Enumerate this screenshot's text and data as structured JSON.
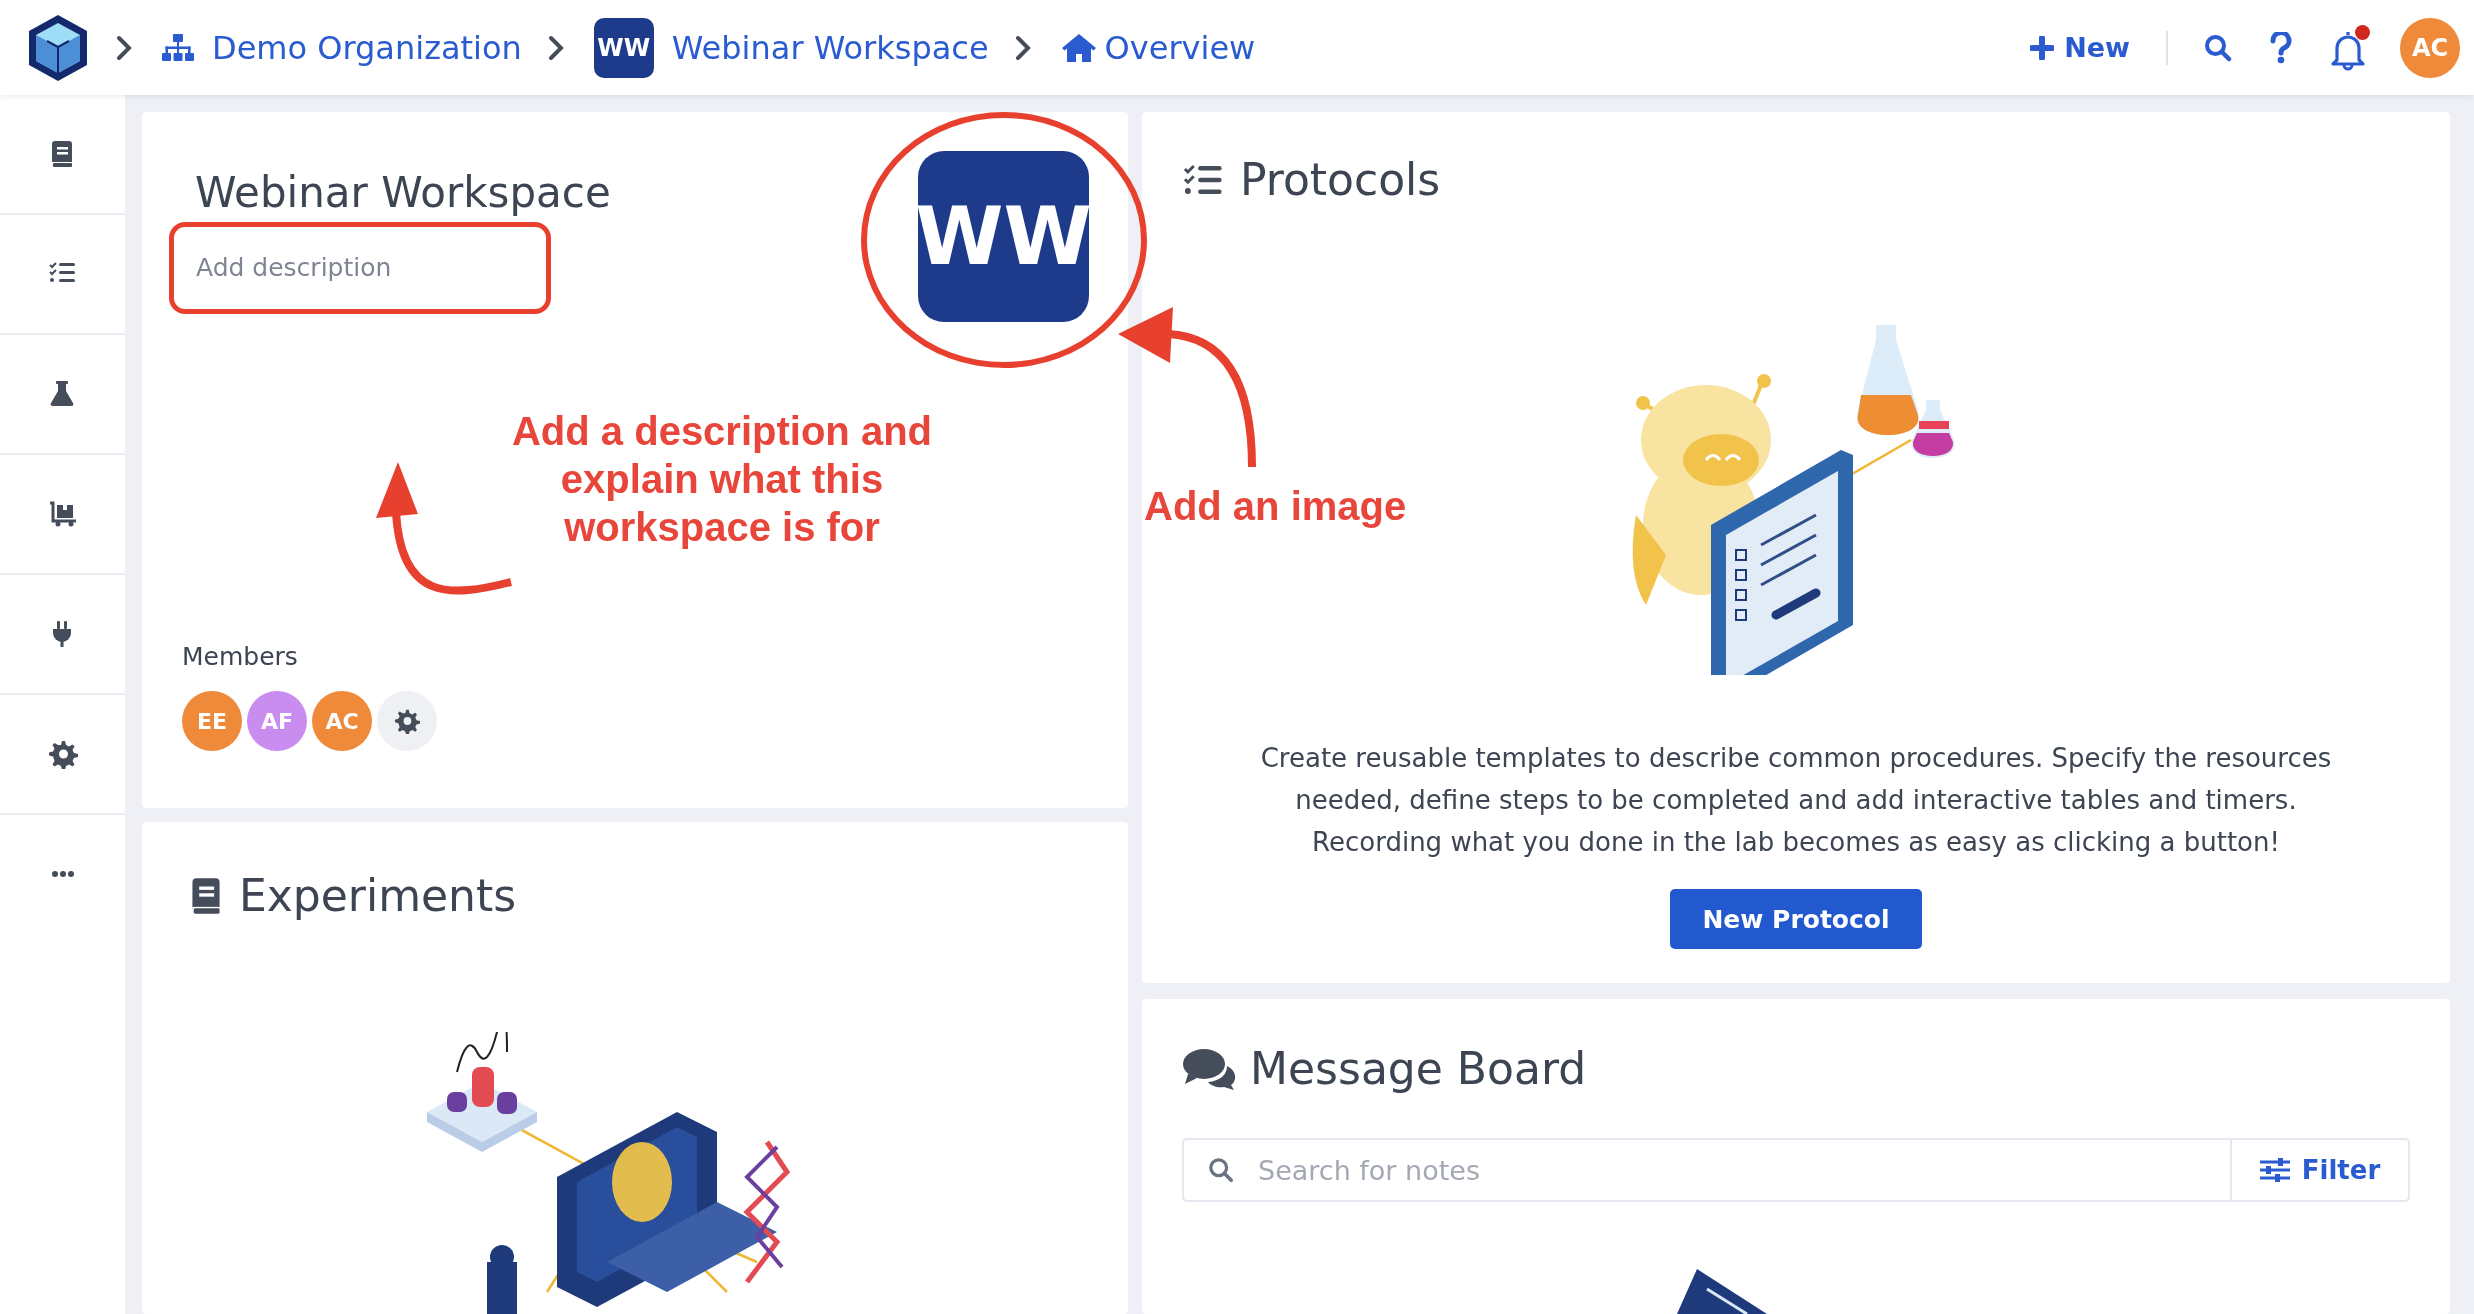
{
  "breadcrumb": [
    {
      "kind": "org",
      "label": "Demo Organization"
    },
    {
      "kind": "workspace",
      "badge": "WW",
      "label": "Webinar Workspace"
    },
    {
      "kind": "home",
      "label": "Overview"
    }
  ],
  "topbar": {
    "new_label": "New",
    "notifications_unread": true,
    "user_initials": "AC"
  },
  "workspace": {
    "title": "Webinar Workspace",
    "description_placeholder": "Add description",
    "logo": "WW",
    "members_label": "Members",
    "members": [
      {
        "initials": "EE",
        "color": "#ef8a3b"
      },
      {
        "initials": "AF",
        "color": "#c98cef"
      },
      {
        "initials": "AC",
        "color": "#ef8a3b"
      }
    ]
  },
  "annotations": [
    {
      "kind": "description",
      "text": "Add a description and\nexplain what this\nworkspace is for"
    },
    {
      "kind": "image",
      "text": "Add an image"
    }
  ],
  "experiments": {
    "title": "Experiments"
  },
  "protocols": {
    "title": "Protocols",
    "description": "Create reusable templates to describe common procedures. Specify the resources needed, define steps to be completed and add interactive tables and timers. Recording what you done in the lab becomes as easy as clicking a button!",
    "button": "New Protocol"
  },
  "message_board": {
    "title": "Message Board",
    "search_placeholder": "Search for notes",
    "filter_label": "Filter"
  }
}
